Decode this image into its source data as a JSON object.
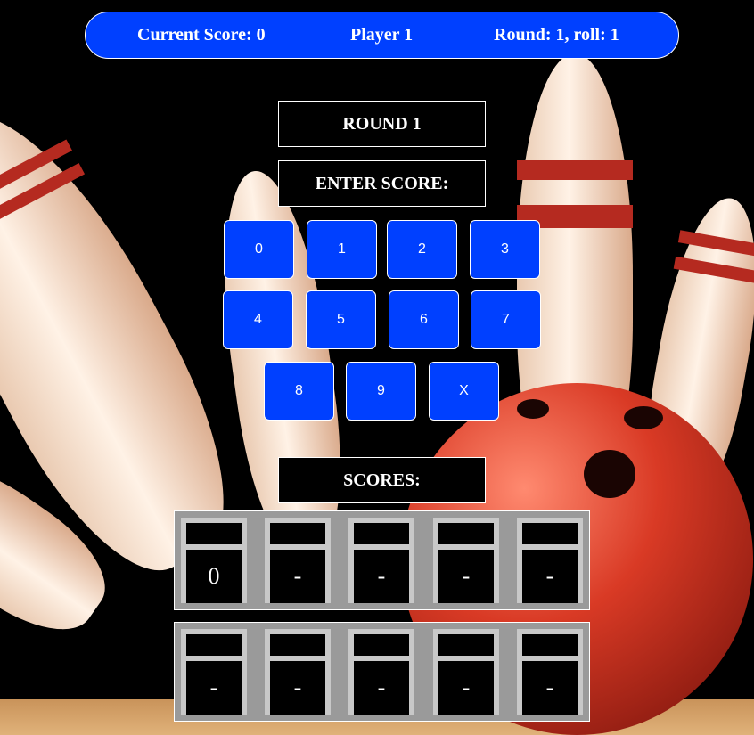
{
  "header": {
    "current_score": "Current Score: 0",
    "player": "Player 1",
    "round_roll": "Round: 1, roll: 1"
  },
  "round_label": "ROUND 1",
  "enter_score_label": "ENTER SCORE:",
  "buttons": [
    "0",
    "1",
    "2",
    "3",
    "4",
    "5",
    "6",
    "7",
    "8",
    "9",
    "X"
  ],
  "scores_label": "SCORES:",
  "frames": [
    {
      "top": "",
      "bottom": "0"
    },
    {
      "top": "",
      "bottom": "-"
    },
    {
      "top": "",
      "bottom": "-"
    },
    {
      "top": "",
      "bottom": "-"
    },
    {
      "top": "",
      "bottom": "-"
    },
    {
      "top": "",
      "bottom": "-"
    },
    {
      "top": "",
      "bottom": "-"
    },
    {
      "top": "",
      "bottom": "-"
    },
    {
      "top": "",
      "bottom": "-"
    },
    {
      "top": "",
      "bottom": "-"
    }
  ],
  "colors": {
    "accent": "#0040ff",
    "panel": "#9a9a9a",
    "cell_frame": "#c8c8c8"
  }
}
